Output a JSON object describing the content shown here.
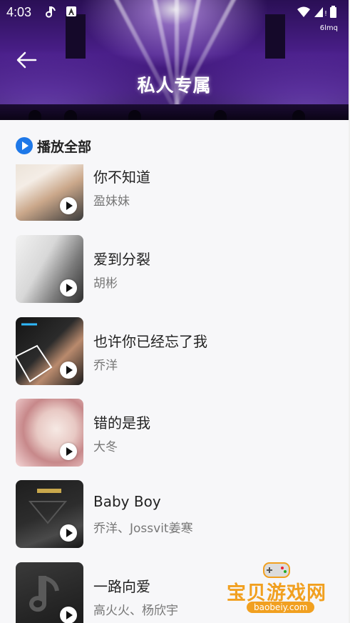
{
  "status_bar": {
    "time": "4:03",
    "carrier": "6lmq"
  },
  "header": {
    "title": "私人专属"
  },
  "play_all": {
    "label": "播放全部"
  },
  "songs": [
    {
      "title": "你不知道",
      "artist": "盈妹妹"
    },
    {
      "title": "爱到分裂",
      "artist": "胡彬"
    },
    {
      "title": "也许你已经忘了我",
      "artist": "乔洋"
    },
    {
      "title": "错的是我",
      "artist": "大冬"
    },
    {
      "title": "Baby Boy",
      "artist": "乔洋、Jossvit姜寒"
    },
    {
      "title": "一路向爱",
      "artist": "高火火、杨欣宇"
    }
  ],
  "watermark": {
    "text": "宝贝游戏网",
    "url": "baobeiy.com"
  },
  "colors": {
    "accent": "#1e78e8",
    "banner": "#4a1f8a",
    "watermark": "#f1a020"
  }
}
